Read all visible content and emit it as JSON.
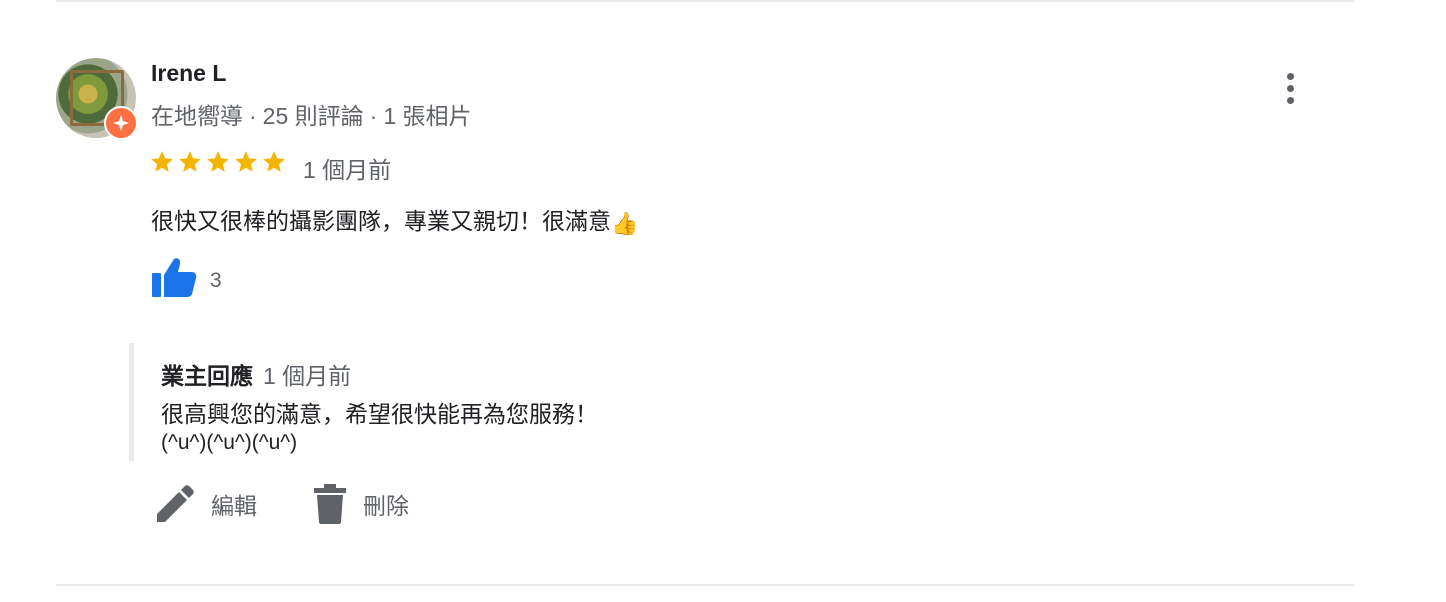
{
  "reviewer": {
    "name": "Irene L",
    "badge": "在地嚮導",
    "reviews": "25 則評論",
    "photos": "1 張相片",
    "separator": "·"
  },
  "review": {
    "rating": 5,
    "rating_max": 5,
    "time": "1 個月前",
    "text": "很快又很棒的攝影團隊，專業又親切！很滿意",
    "emoji": "👍",
    "like_count": "3"
  },
  "owner_reply": {
    "label": "業主回應",
    "time": "1 個月前",
    "line1": "很高興您的滿意，希望很快能再為您服務！",
    "line2": "(^u^)(^u^)(^u^)"
  },
  "actions": {
    "edit_label": "編輯",
    "delete_label": "刪除"
  },
  "colors": {
    "star": "#f4b400",
    "like": "#1a73e8",
    "badge": "#ff7043",
    "secondary_text": "#5f6368"
  },
  "icons": [
    "local-guide-badge-icon",
    "more-vert-icon",
    "star-icon",
    "thumb-up-icon",
    "pencil-icon",
    "trash-icon"
  ]
}
